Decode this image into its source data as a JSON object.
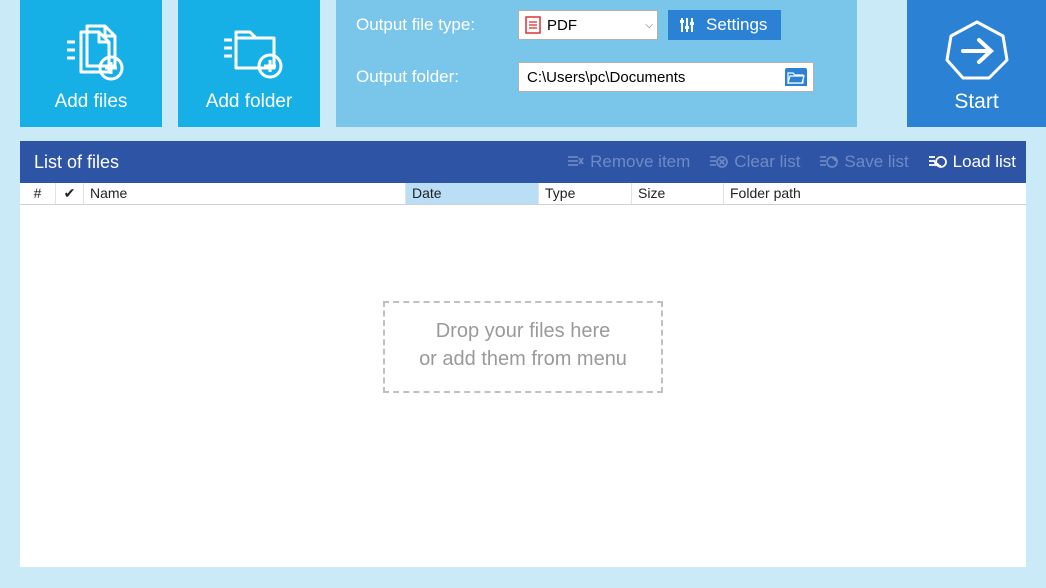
{
  "toolbar": {
    "add_files_label": "Add files",
    "add_folder_label": "Add folder",
    "start_label": "Start"
  },
  "output": {
    "file_type_label": "Output file type:",
    "file_type_value": "PDF",
    "settings_label": "Settings",
    "folder_label": "Output folder:",
    "folder_value": "C:\\Users\\pc\\Documents"
  },
  "list": {
    "title": "List of files",
    "actions": {
      "remove": "Remove item",
      "clear": "Clear list",
      "save": "Save list",
      "load": "Load list"
    },
    "columns": {
      "num": "#",
      "check": "✔",
      "name": "Name",
      "date": "Date",
      "type": "Type",
      "size": "Size",
      "path": "Folder path"
    },
    "drop_line1": "Drop your files here",
    "drop_line2": "or add them from menu"
  },
  "colors": {
    "bg": "#cbeaf7",
    "panel_light": "#7ac6ea",
    "accent_cyan": "#16b0e6",
    "primary_blue": "#2b82d4",
    "header_blue": "#2e54a6",
    "disabled_text": "#6f8bc6"
  }
}
